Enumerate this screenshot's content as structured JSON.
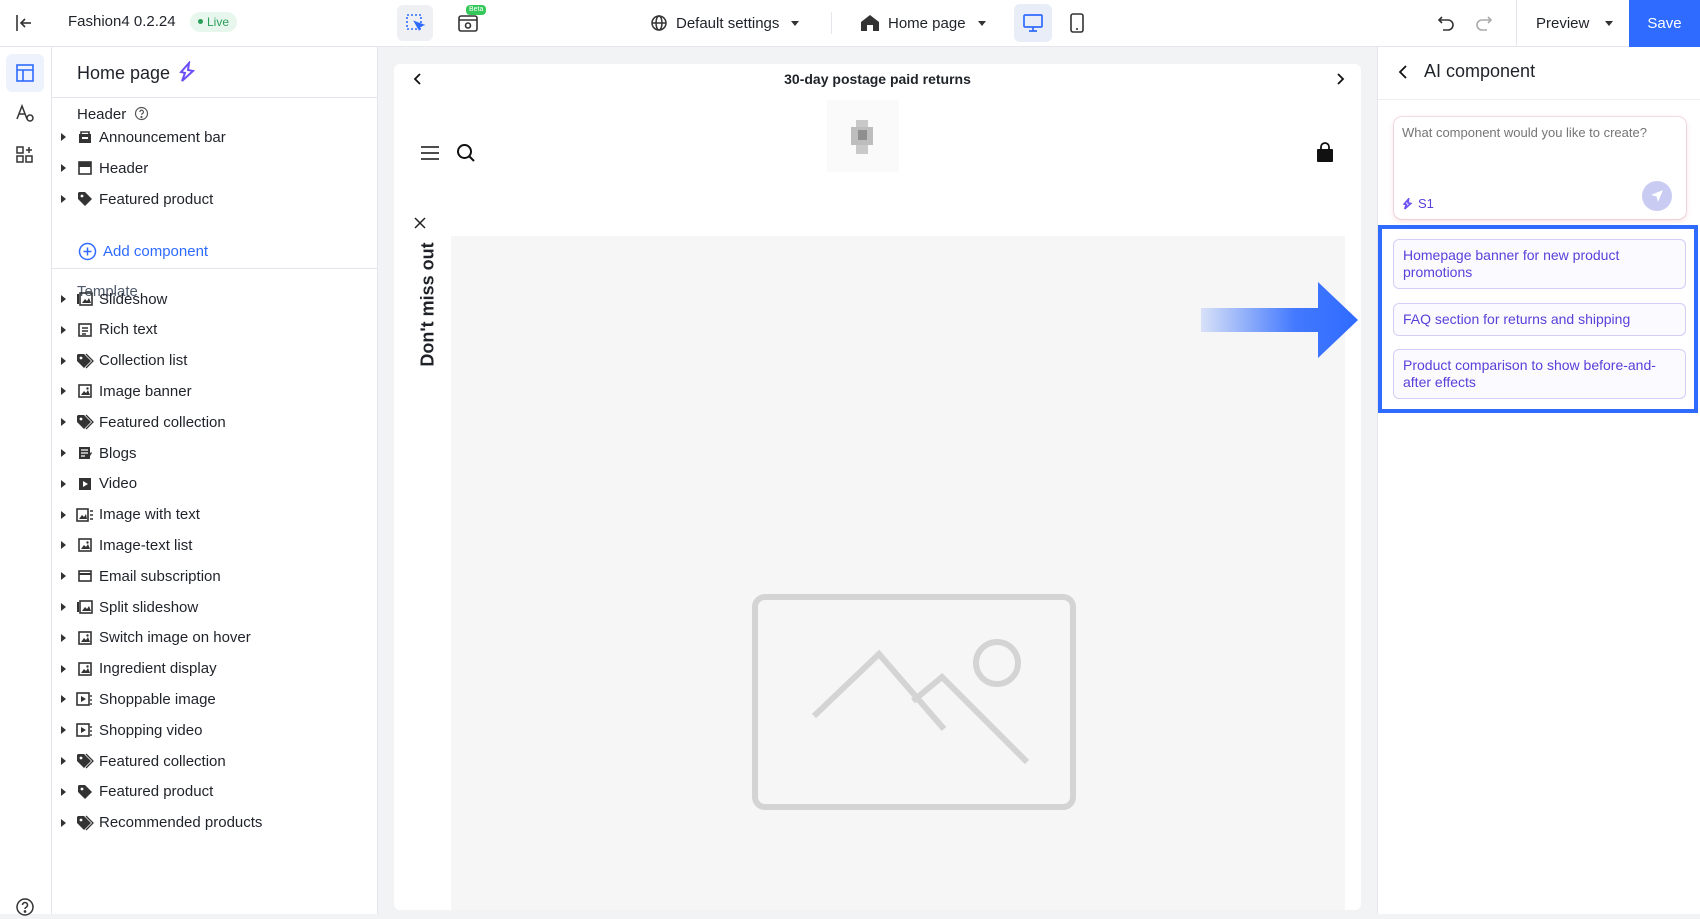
{
  "topbar": {
    "app_name": "Fashion4",
    "version": "0.2.24",
    "live_label": "Live",
    "beta_label": "Beta",
    "settings_label": "Default settings",
    "page_label": "Home page",
    "preview_label": "Preview",
    "save_label": "Save"
  },
  "left_panel": {
    "title": "Home page",
    "header_group": "Header",
    "header_items": [
      {
        "label": "Announcement bar",
        "icon": "bell-icon"
      },
      {
        "label": "Header",
        "icon": "header-icon"
      },
      {
        "label": "Featured product",
        "icon": "tag-icon"
      }
    ],
    "add_component": "Add component",
    "template_group": "Template",
    "template_items": [
      {
        "label": "Slideshow",
        "icon": "slideshow-icon"
      },
      {
        "label": "Rich text",
        "icon": "rich-text-icon"
      },
      {
        "label": "Collection list",
        "icon": "tags-icon"
      },
      {
        "label": "Image banner",
        "icon": "image-icon"
      },
      {
        "label": "Featured collection",
        "icon": "tags-icon"
      },
      {
        "label": "Blogs",
        "icon": "blog-icon"
      },
      {
        "label": "Video",
        "icon": "video-icon"
      },
      {
        "label": "Image with text",
        "icon": "image-text-icon"
      },
      {
        "label": "Image-text list",
        "icon": "image-icon"
      },
      {
        "label": "Email subscription",
        "icon": "email-icon"
      },
      {
        "label": "Split slideshow",
        "icon": "slideshow-icon"
      },
      {
        "label": "Switch image on hover",
        "icon": "image-icon"
      },
      {
        "label": "Ingredient display",
        "icon": "image-icon"
      },
      {
        "label": "Shoppable image",
        "icon": "shoppable-icon"
      },
      {
        "label": "Shopping video",
        "icon": "shoppable-icon"
      },
      {
        "label": "Featured collection",
        "icon": "tags-icon"
      },
      {
        "label": "Featured product",
        "icon": "tag-icon"
      },
      {
        "label": "Recommended products",
        "icon": "tags-icon"
      }
    ]
  },
  "preview": {
    "announcement": "30-day postage paid returns",
    "popup_label": "Don't miss out"
  },
  "right_panel": {
    "title": "AI component",
    "prompt_placeholder": "What component would you like to create?",
    "model_label": "S1",
    "suggestions": [
      "Homepage banner for new product promotions",
      "FAQ section for returns and shipping",
      "Product comparison to show before-and-after effects"
    ]
  },
  "colors": {
    "accent": "#2f6bff",
    "ai_purple": "#5b3fd9",
    "live_green": "#2b9e58"
  }
}
